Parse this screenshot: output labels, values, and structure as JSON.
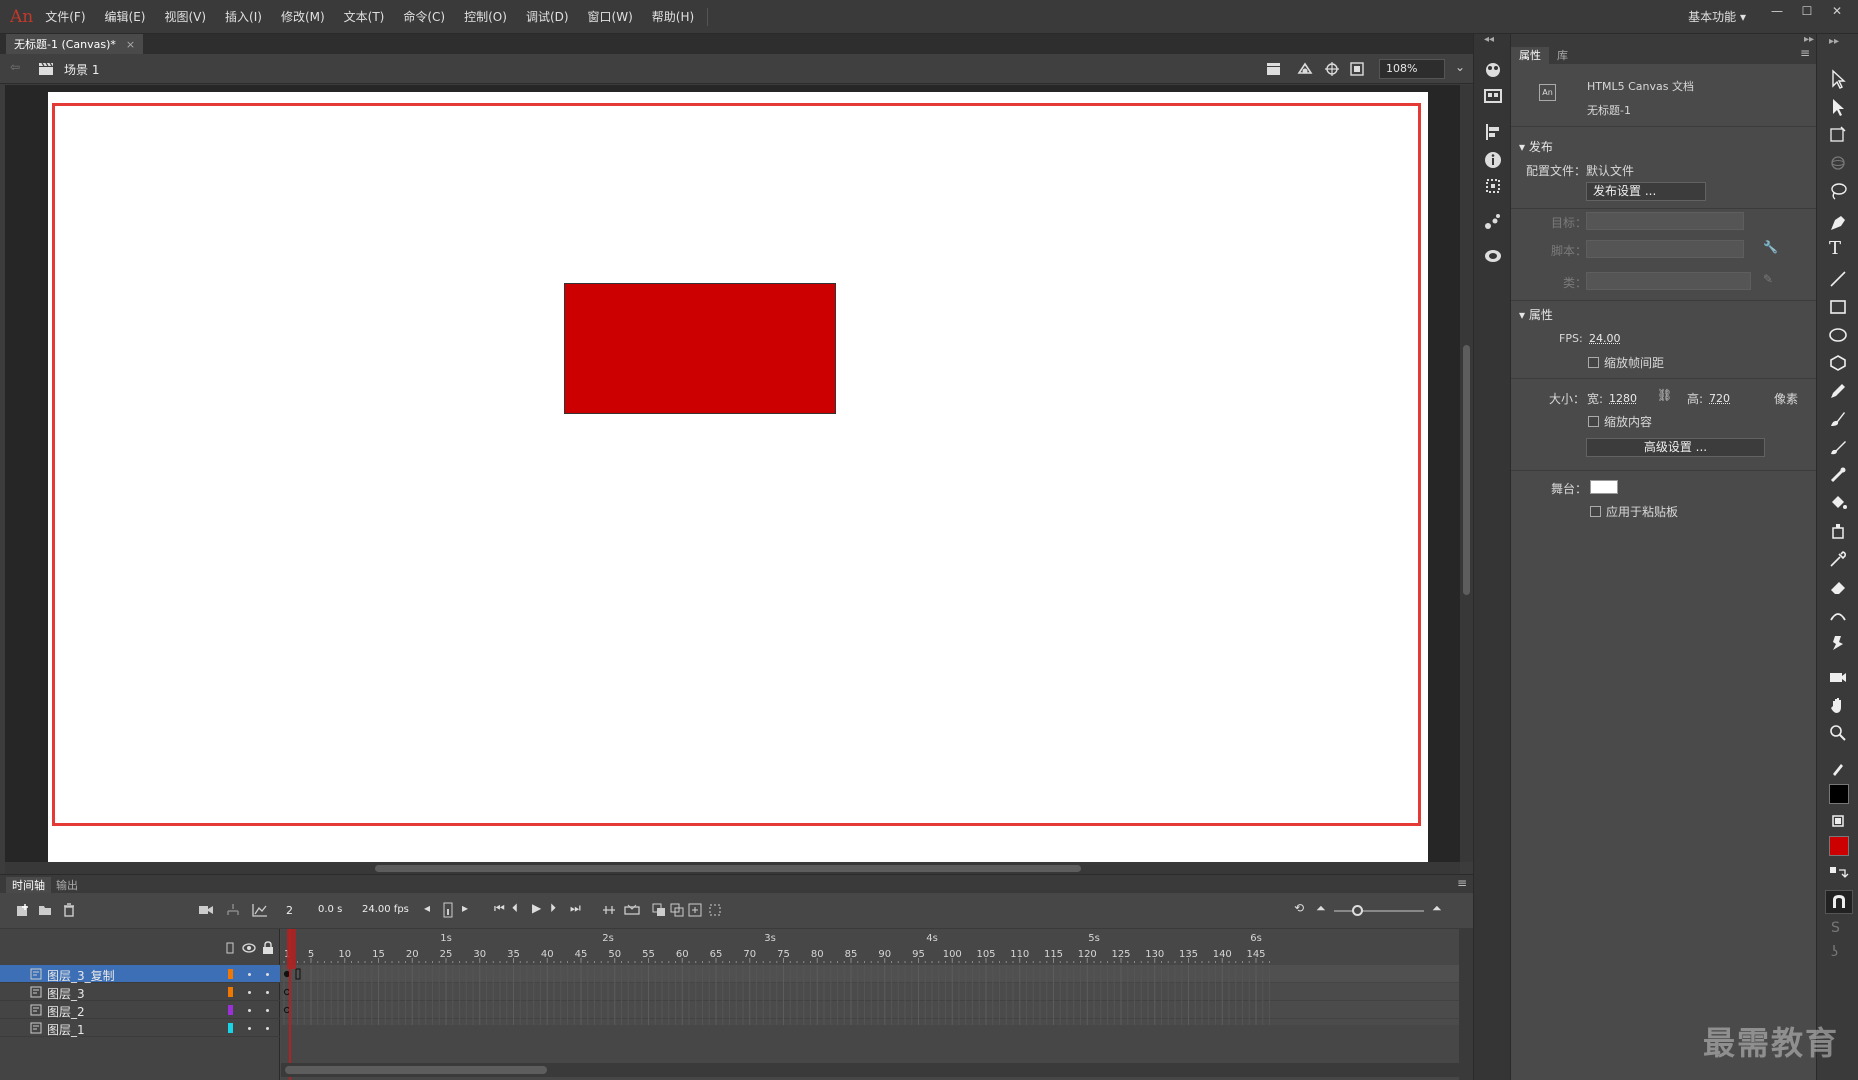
{
  "app": {
    "logo": "An",
    "workspace": "基本功能"
  },
  "menu": [
    "文件(F)",
    "编辑(E)",
    "视图(V)",
    "插入(I)",
    "修改(M)",
    "文本(T)",
    "命令(C)",
    "控制(O)",
    "调试(D)",
    "窗口(W)",
    "帮助(H)"
  ],
  "document": {
    "tab_title": "无标题-1 (Canvas)*",
    "close": "×",
    "scene": "场景 1",
    "zoom": "108%"
  },
  "properties": {
    "tabs": [
      "属性",
      "库"
    ],
    "doc_type": "HTML5 Canvas 文档",
    "doc_name": "无标题-1",
    "doc_icon": "An",
    "publish": {
      "title": "发布",
      "profile_label": "配置文件：",
      "profile_value": "默认文件",
      "settings_button": "发布设置 ...",
      "target_label": "目标：",
      "script_label": "脚本：",
      "class_label": "类："
    },
    "attrs": {
      "title": "属性",
      "fps_label": "FPS:",
      "fps_value": "24.00",
      "scale_spans": "缩放帧间距",
      "size_label": "大小：",
      "width_label": "宽:",
      "width_value": "1280",
      "height_label": "高:",
      "height_value": "720",
      "unit": "像素",
      "scale_content": "缩放内容",
      "advanced_button": "高级设置 ...",
      "stage_label": "舞台：",
      "stage_color": "#ffffff",
      "apply_pasteboard": "应用于粘贴板"
    }
  },
  "timeline": {
    "tabs": [
      "时间轴",
      "输出"
    ],
    "frame": "2",
    "time": "0.0 s",
    "fps": "24.00 fps",
    "seconds": [
      "1s",
      "2s",
      "3s",
      "4s",
      "5s",
      "6s"
    ],
    "ruler": [
      "1",
      "5",
      "10",
      "15",
      "20",
      "25",
      "30",
      "35",
      "40",
      "45",
      "50",
      "55",
      "60",
      "65",
      "70",
      "75",
      "80",
      "85",
      "90",
      "95",
      "100",
      "105",
      "110",
      "115",
      "120",
      "125",
      "130",
      "135",
      "140",
      "145"
    ],
    "layers": [
      {
        "name": "图层_3_复制",
        "color": "#f07800",
        "selected": true
      },
      {
        "name": "图层_3",
        "color": "#f07800",
        "selected": false
      },
      {
        "name": "图层_2",
        "color": "#9b30d9",
        "selected": false
      },
      {
        "name": "图层_1",
        "color": "#19d3e6",
        "selected": false
      }
    ]
  },
  "tools": {
    "stroke_color": "#000000",
    "fill_color": "#cc0000"
  },
  "stage": {
    "shape_color": "#cc0000",
    "guide_color": "#e53935"
  },
  "watermark": "最需教育"
}
